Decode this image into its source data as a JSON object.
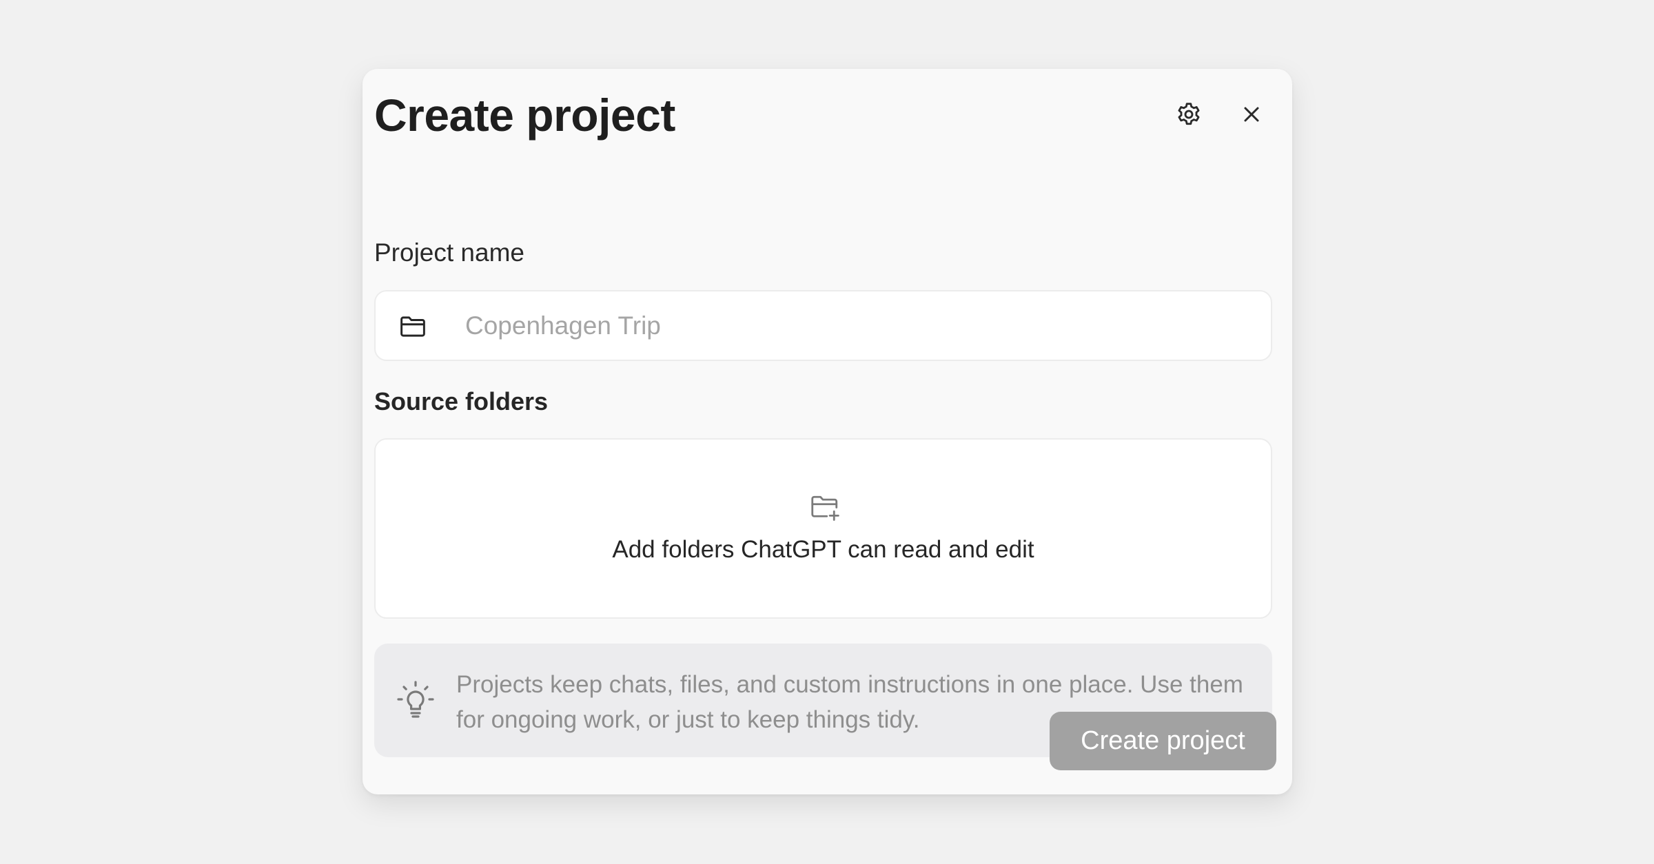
{
  "dialog": {
    "title": "Create project",
    "settings_icon": "gear-icon",
    "close_icon": "close-icon"
  },
  "project_name": {
    "label": "Project name",
    "icon": "folder-icon",
    "placeholder": "Copenhagen Trip",
    "value": ""
  },
  "source_folders": {
    "label": "Source folders",
    "icon": "folder-add-icon",
    "drop_text": "Add folders ChatGPT can read and edit"
  },
  "tip": {
    "icon": "lightbulb-icon",
    "text": "Projects keep chats, files, and custom instructions in one place. Use them for ongoing work, or just to keep things tidy."
  },
  "actions": {
    "create_label": "Create project",
    "create_enabled": false
  },
  "colors": {
    "page_background": "#f1f1f1",
    "dialog_background": "#f9f9f9",
    "button_disabled": "#a2a2a2",
    "tip_background": "#ececee",
    "muted_text": "#8e8e8e"
  }
}
